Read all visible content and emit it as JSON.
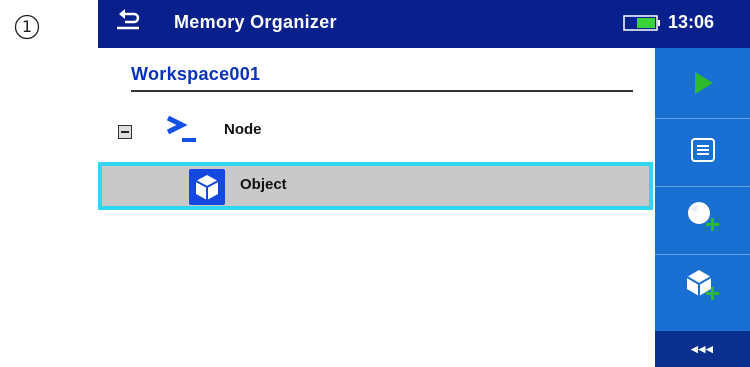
{
  "step": {
    "number": "1"
  },
  "header": {
    "title": "Memory Organizer",
    "time": "13:06",
    "back_icon": "back-arrow-icon",
    "battery_icon": "battery-icon"
  },
  "workspace": {
    "name": "Workspace001"
  },
  "tree": {
    "node": {
      "label": "Node",
      "icon": "node-prompt-icon",
      "expander": "collapse-icon"
    },
    "object": {
      "label": "Object",
      "icon": "object-cube-icon",
      "selected": true
    }
  },
  "sidebar": {
    "items": [
      {
        "name": "play-icon"
      },
      {
        "name": "list-icon"
      },
      {
        "name": "add-node-icon"
      },
      {
        "name": "add-object-icon"
      }
    ],
    "more_label": "◂◂◂"
  },
  "colors": {
    "header_bg": "#07208c",
    "sidebar_bg": "#1a6fd2",
    "selection_border": "#2fd7f2",
    "selection_bg": "#c9c9c9",
    "accent_green": "#2dbb2d",
    "workspace_text": "#0a32b8"
  }
}
